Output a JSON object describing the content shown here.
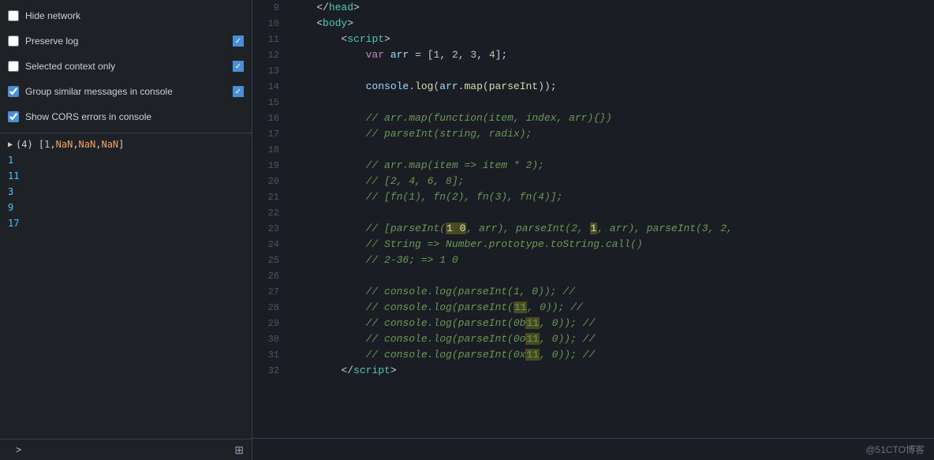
{
  "left": {
    "settings": [
      {
        "id": "hide-network",
        "label": "Hide network",
        "checked": false,
        "hasBlueRight": false
      },
      {
        "id": "preserve-log",
        "label": "Preserve log",
        "checked": false,
        "hasBlueRight": true
      },
      {
        "id": "selected-context",
        "label": "Selected context only",
        "checked": false,
        "hasBlueRight": true
      },
      {
        "id": "group-similar",
        "label": "Group similar messages in console",
        "checked": true,
        "hasBlueRight": true
      },
      {
        "id": "show-cors",
        "label": "Show CORS errors in console",
        "checked": true,
        "hasBlueRight": false
      }
    ],
    "console_output": [
      {
        "type": "array",
        "text": "▶ (4) [1, NaN, NaN, NaN]"
      },
      {
        "type": "number",
        "text": "1"
      },
      {
        "type": "number",
        "text": "11"
      },
      {
        "type": "number",
        "text": "3"
      },
      {
        "type": "number",
        "text": "9"
      },
      {
        "type": "number",
        "text": "17"
      }
    ],
    "expand_arrow": ">"
  },
  "right": {
    "lines": [
      {
        "num": "9",
        "html": "tag-close head"
      },
      {
        "num": "10",
        "html": "tag-open body"
      },
      {
        "num": "11",
        "html": "tag-open script"
      },
      {
        "num": "12",
        "html": "code var arr"
      },
      {
        "num": "13",
        "html": "empty"
      },
      {
        "num": "14",
        "html": "code console log arr map parseInt"
      },
      {
        "num": "15",
        "html": "empty"
      },
      {
        "num": "16",
        "html": "comment arr.map"
      },
      {
        "num": "17",
        "html": "comment parseInt string radix"
      },
      {
        "num": "18",
        "html": "empty"
      },
      {
        "num": "19",
        "html": "comment arr.map item"
      },
      {
        "num": "20",
        "html": "comment 2 4 6 8"
      },
      {
        "num": "21",
        "html": "comment fn1 fn2 fn3 fn4"
      },
      {
        "num": "22",
        "html": "empty"
      },
      {
        "num": "23",
        "html": "comment parseInt 1 0 arr"
      },
      {
        "num": "24",
        "html": "comment String Number"
      },
      {
        "num": "25",
        "html": "comment 2-36"
      },
      {
        "num": "26",
        "html": "empty"
      },
      {
        "num": "27",
        "html": "comment console.log parseInt 1 0"
      },
      {
        "num": "28",
        "html": "comment console.log parseInt 11 0"
      },
      {
        "num": "29",
        "html": "comment console.log parseInt 0b11 0"
      },
      {
        "num": "30",
        "html": "comment console.log parseInt 0o11 0"
      },
      {
        "num": "31",
        "html": "comment console.log parseInt 0x11 0"
      },
      {
        "num": "32",
        "html": "tag-close script"
      }
    ]
  },
  "watermark": "@51CTO博客"
}
